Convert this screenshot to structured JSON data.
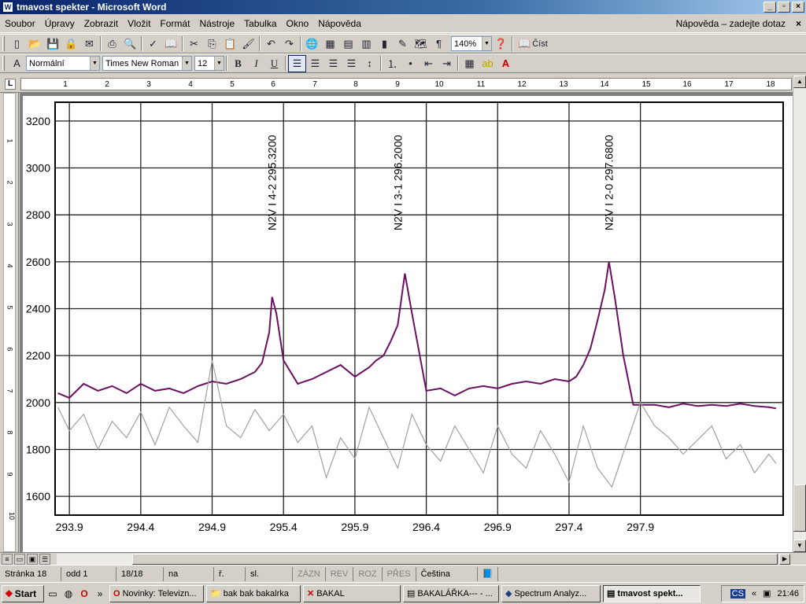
{
  "window": {
    "title": "tmavost spekter - Microsoft Word"
  },
  "menu": {
    "items": [
      "Soubor",
      "Úpravy",
      "Zobrazit",
      "Vložit",
      "Formát",
      "Nástroje",
      "Tabulka",
      "Okno",
      "Nápověda"
    ],
    "help_box": "Nápověda – zadejte dotaz",
    "close": "×"
  },
  "toolbar": {
    "zoom": "140%",
    "read_label": "Číst",
    "style": "Normální",
    "font": "Times New Roman",
    "size": "12",
    "bold": "B",
    "italic": "I",
    "underline": "U"
  },
  "ruler": {
    "corner": "L",
    "numbers": [
      "1",
      "2",
      "3",
      "4",
      "5",
      "6",
      "7",
      "8",
      "9",
      "10",
      "11",
      "12",
      "13",
      "14",
      "15",
      "16",
      "17",
      "18"
    ],
    "vnumbers": [
      "1",
      "2",
      "3",
      "4",
      "5",
      "6",
      "7",
      "8",
      "9",
      "10"
    ]
  },
  "status": {
    "page": "Stránka 18",
    "section": "odd 1",
    "pages": "18/18",
    "at": "na",
    "line": "ř.",
    "col": "sl.",
    "rec": "ZÁZN",
    "rev": "REV",
    "ext": "ROZ",
    "ovr": "PŘES",
    "lang": "Čeština"
  },
  "taskbar": {
    "start": "Start",
    "tasks": [
      "Novinky: Televizn...",
      "bak bak bakalrka",
      "BAKAL",
      "BAKALÁŘKA--- - ...",
      "Spectrum Analyz...",
      "tmavost spekt..."
    ],
    "lang": "CS",
    "time": "21:46"
  },
  "chart_data": {
    "type": "line",
    "xlim": [
      293.8,
      298.9
    ],
    "ylim": [
      1520,
      3280
    ],
    "xticks": [
      293.9,
      294.4,
      294.9,
      295.4,
      295.9,
      296.4,
      296.9,
      297.4,
      297.9
    ],
    "yticks": [
      1600,
      1800,
      2000,
      2200,
      2400,
      2600,
      2800,
      3000,
      3200
    ],
    "grid": true,
    "annotations": [
      {
        "text": "N2V I 4-2 295.3200",
        "x": 295.32
      },
      {
        "text": "N2V I 3-1 296.2000",
        "x": 296.2
      },
      {
        "text": "N2V I 2-0 297.6800",
        "x": 297.68
      }
    ],
    "series": [
      {
        "color": "#6b1060",
        "x": [
          293.82,
          293.9,
          294.0,
          294.1,
          294.2,
          294.3,
          294.4,
          294.5,
          294.6,
          294.7,
          294.8,
          294.9,
          295.0,
          295.1,
          295.2,
          295.25,
          295.3,
          295.32,
          295.35,
          295.4,
          295.5,
          295.6,
          295.7,
          295.8,
          295.9,
          296.0,
          296.05,
          296.1,
          296.15,
          296.2,
          296.25,
          296.3,
          296.4,
          296.5,
          296.6,
          296.7,
          296.8,
          296.9,
          297.0,
          297.1,
          297.2,
          297.3,
          297.4,
          297.45,
          297.5,
          297.55,
          297.6,
          297.65,
          297.68,
          297.72,
          297.78,
          297.85,
          297.9,
          298.0,
          298.1,
          298.2,
          298.3,
          298.4,
          298.5,
          298.6,
          298.7,
          298.8,
          298.85
        ],
        "values": [
          2040,
          2020,
          2080,
          2050,
          2070,
          2040,
          2080,
          2050,
          2060,
          2040,
          2070,
          2090,
          2080,
          2100,
          2130,
          2170,
          2300,
          2450,
          2380,
          2180,
          2080,
          2100,
          2130,
          2160,
          2110,
          2150,
          2180,
          2200,
          2260,
          2330,
          2550,
          2380,
          2050,
          2060,
          2030,
          2060,
          2070,
          2060,
          2080,
          2090,
          2080,
          2100,
          2090,
          2110,
          2160,
          2230,
          2350,
          2480,
          2600,
          2450,
          2200,
          1990,
          1990,
          1990,
          1980,
          1995,
          1985,
          1990,
          1985,
          1995,
          1985,
          1980,
          1975
        ]
      },
      {
        "color": "#a0a0a0",
        "x": [
          293.82,
          293.9,
          294.0,
          294.1,
          294.2,
          294.3,
          294.4,
          294.5,
          294.6,
          294.7,
          294.8,
          294.9,
          295.0,
          295.1,
          295.2,
          295.3,
          295.4,
          295.5,
          295.6,
          295.7,
          295.8,
          295.9,
          296.0,
          296.1,
          296.2,
          296.3,
          296.4,
          296.5,
          296.6,
          296.7,
          296.8,
          296.9,
          297.0,
          297.1,
          297.2,
          297.3,
          297.4,
          297.5,
          297.6,
          297.7,
          297.8,
          297.9,
          298.0,
          298.1,
          298.2,
          298.3,
          298.4,
          298.5,
          298.6,
          298.7,
          298.8,
          298.85
        ],
        "values": [
          1980,
          1880,
          1950,
          1800,
          1920,
          1850,
          1960,
          1820,
          1980,
          1900,
          1830,
          2180,
          1900,
          1850,
          1970,
          1880,
          1950,
          1830,
          1900,
          1680,
          1850,
          1760,
          1980,
          1850,
          1720,
          1950,
          1820,
          1750,
          1900,
          1800,
          1700,
          1900,
          1780,
          1720,
          1880,
          1780,
          1660,
          1900,
          1720,
          1640,
          1820,
          2000,
          1900,
          1850,
          1780,
          1840,
          1900,
          1760,
          1820,
          1700,
          1780,
          1740
        ]
      }
    ]
  }
}
